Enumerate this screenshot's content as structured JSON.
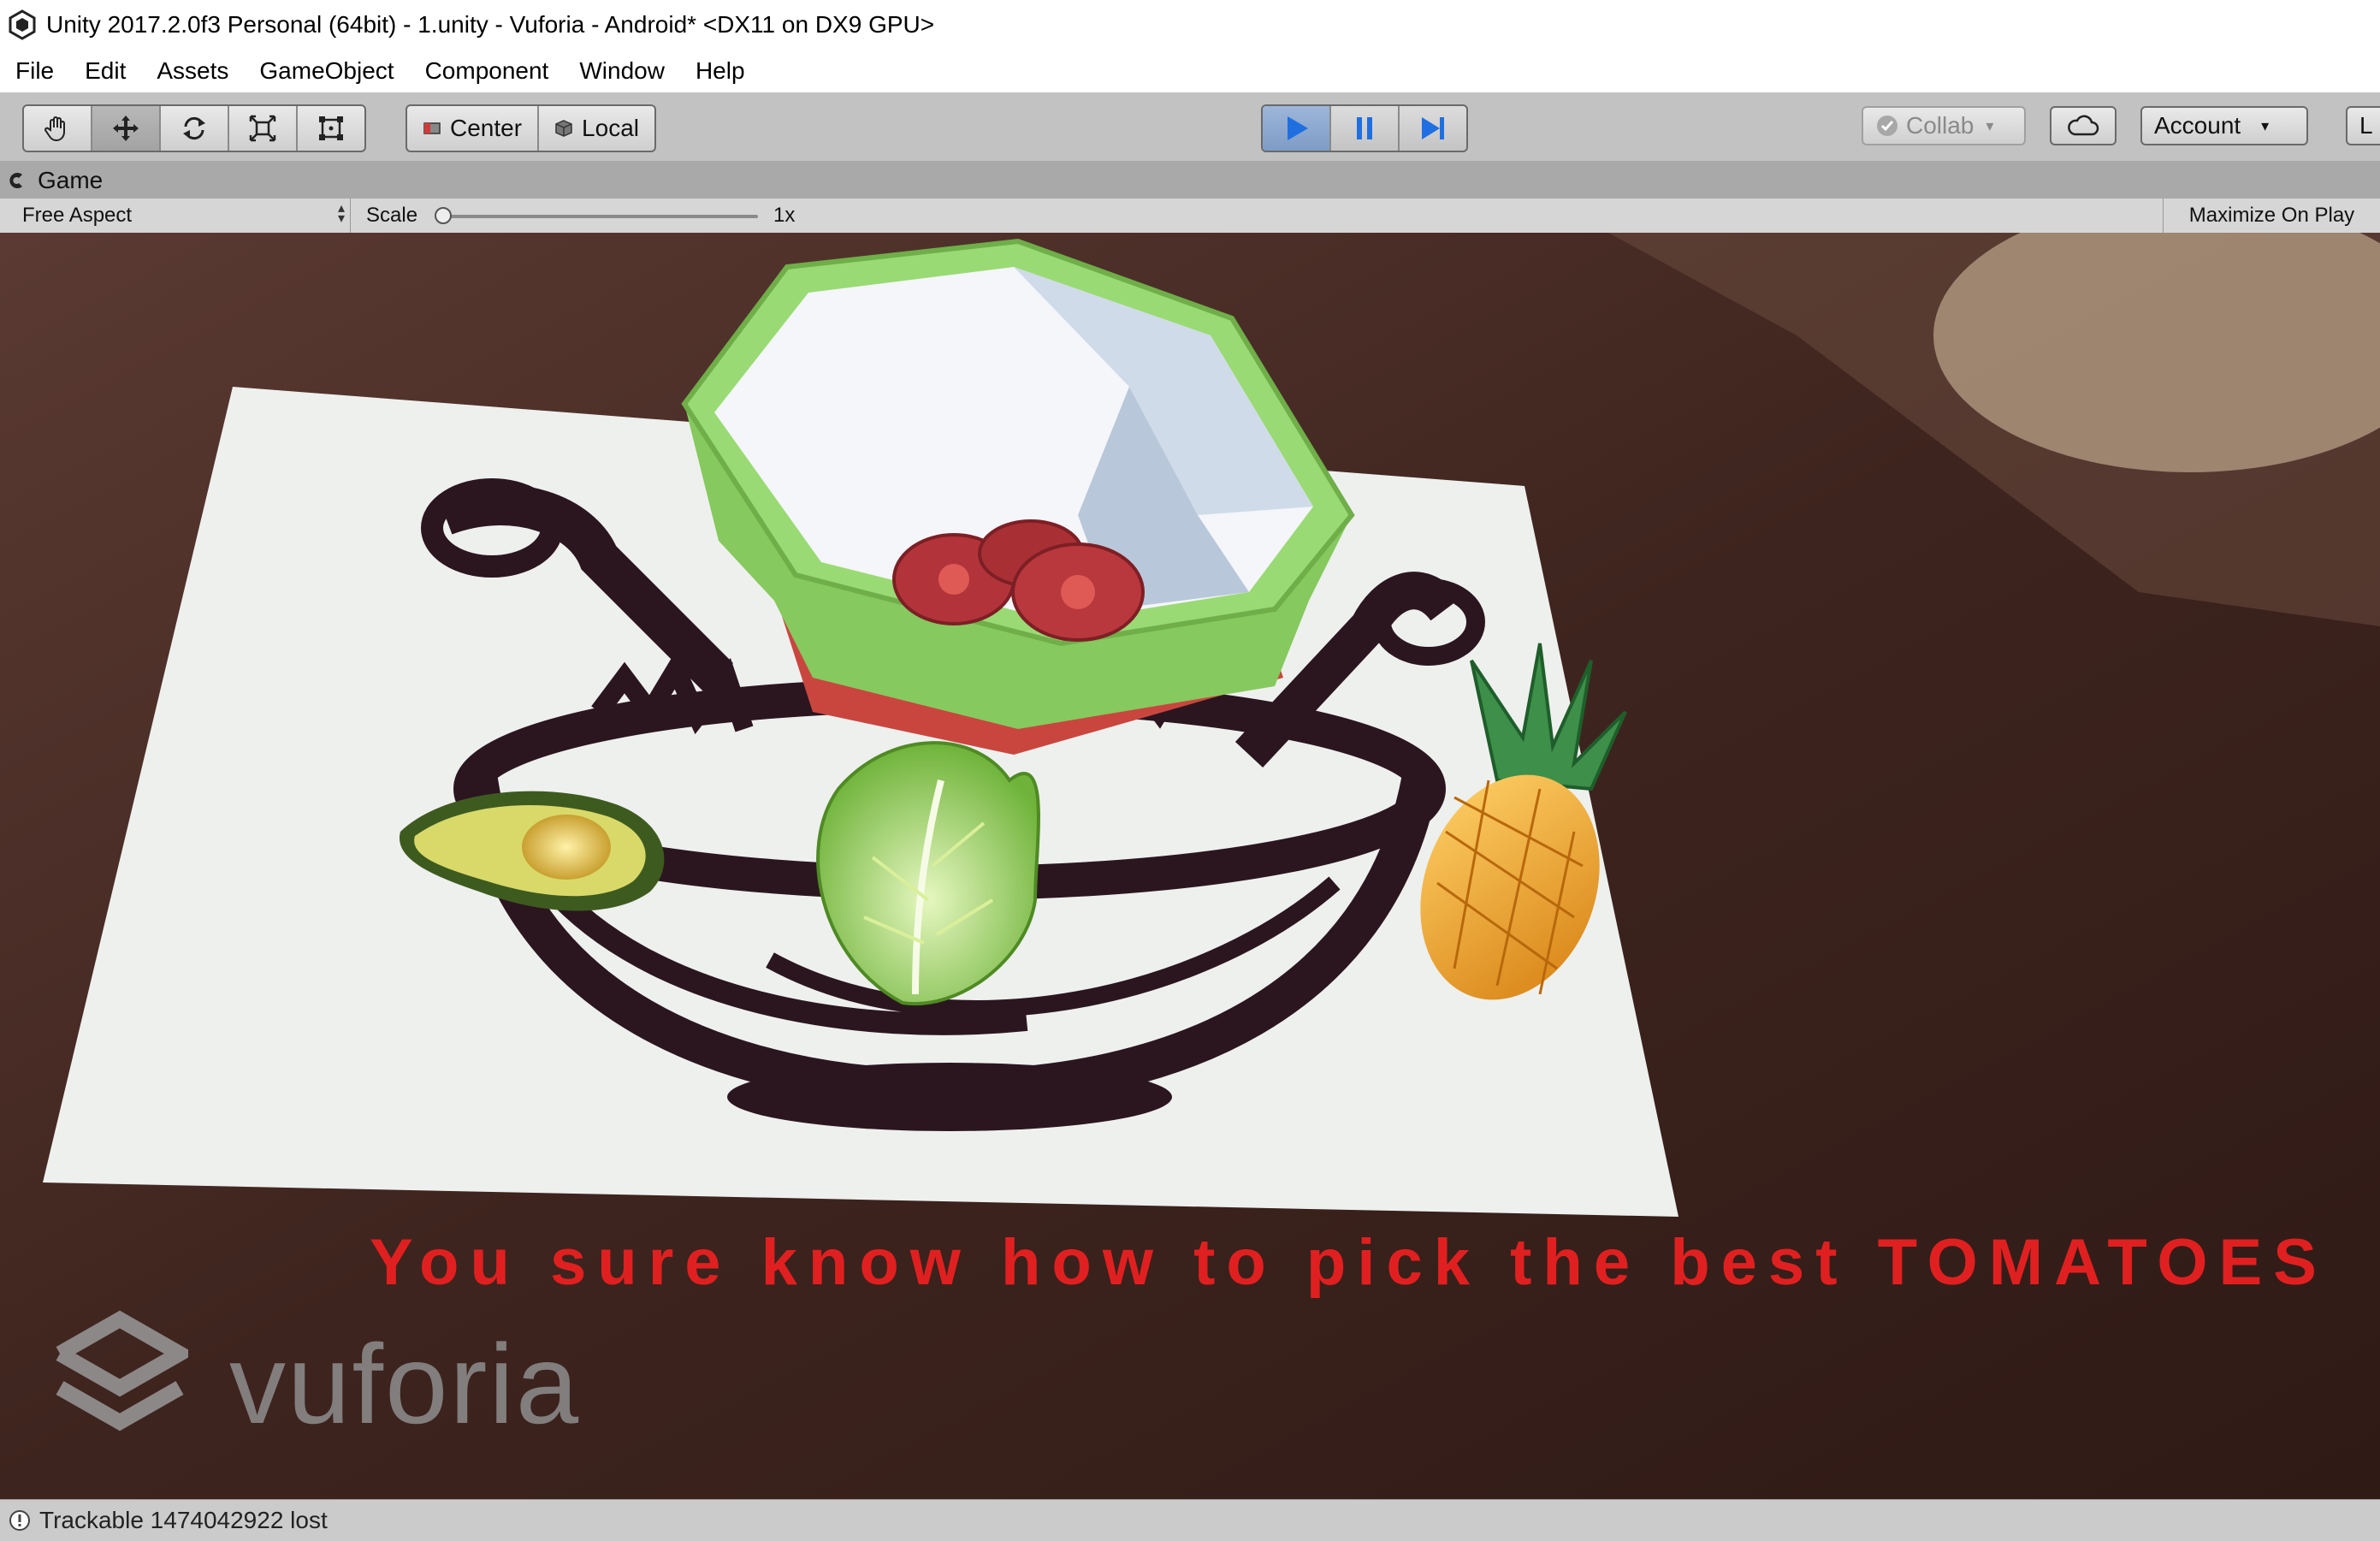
{
  "window": {
    "title": "Unity 2017.2.0f3 Personal (64bit) - 1.unity - Vuforia - Android* <DX11 on DX9 GPU>"
  },
  "menu": [
    "File",
    "Edit",
    "Assets",
    "GameObject",
    "Component",
    "Window",
    "Help"
  ],
  "toolbar": {
    "transform_tools": [
      "hand-tool-icon",
      "move-tool-icon",
      "rotate-tool-icon",
      "scale-tool-icon",
      "rect-tool-icon"
    ],
    "pivot_mode": "Center",
    "pivot_rotation": "Local",
    "collab_label": "Collab",
    "account_label": "Account",
    "layers_label": "L"
  },
  "game_view": {
    "tab_label": "Game",
    "aspect": "Free Aspect",
    "scale_label": "Scale",
    "scale_value": "1x",
    "maximize_label": "Maximize On Play"
  },
  "scene": {
    "message": "You sure know how to pick the best TOMATOES",
    "watermark": "vuforia"
  },
  "status": {
    "message": "Trackable 1474042922 lost"
  },
  "colors": {
    "message_red": "#e02020",
    "play_active": "#1f6fe0",
    "bowl_green": "#8fd26a",
    "bowl_red": "#c9463f",
    "table_brown": "#4a2a22"
  }
}
